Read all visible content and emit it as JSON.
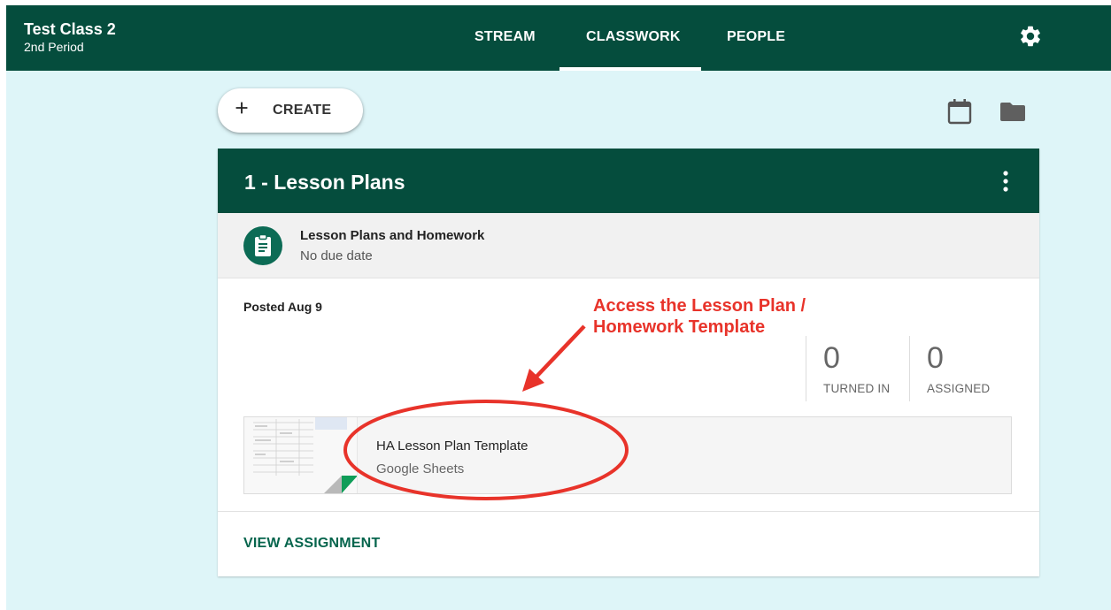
{
  "header": {
    "class_title": "Test Class 2",
    "class_subtitle": "2nd Period",
    "tabs": [
      {
        "label": "STREAM",
        "active": false
      },
      {
        "label": "CLASSWORK",
        "active": true
      },
      {
        "label": "PEOPLE",
        "active": false
      }
    ],
    "settings_icon": "gear-icon"
  },
  "toolbar": {
    "create_label": "CREATE",
    "create_icon": "plus-icon",
    "calendar_icon": "calendar-icon",
    "folder_icon": "folder-icon"
  },
  "topic": {
    "title": "1 - Lesson Plans",
    "menu_icon": "more-vert-icon"
  },
  "assignment": {
    "icon": "assignment-icon",
    "title": "Lesson Plans and Homework",
    "due": "No due date",
    "posted": "Posted Aug 9",
    "stats": [
      {
        "value": "0",
        "label": "TURNED IN"
      },
      {
        "value": "0",
        "label": "ASSIGNED"
      }
    ],
    "attachment": {
      "title": "HA Lesson Plan Template",
      "type": "Google Sheets"
    },
    "view_label": "VIEW ASSIGNMENT"
  },
  "annotation": {
    "line1": "Access the Lesson Plan /",
    "line2": "Homework Template"
  },
  "colors": {
    "brand": "#054d3d",
    "background": "#def5f8",
    "annotation": "#e8332a",
    "sheets_green": "#0f9d58"
  }
}
